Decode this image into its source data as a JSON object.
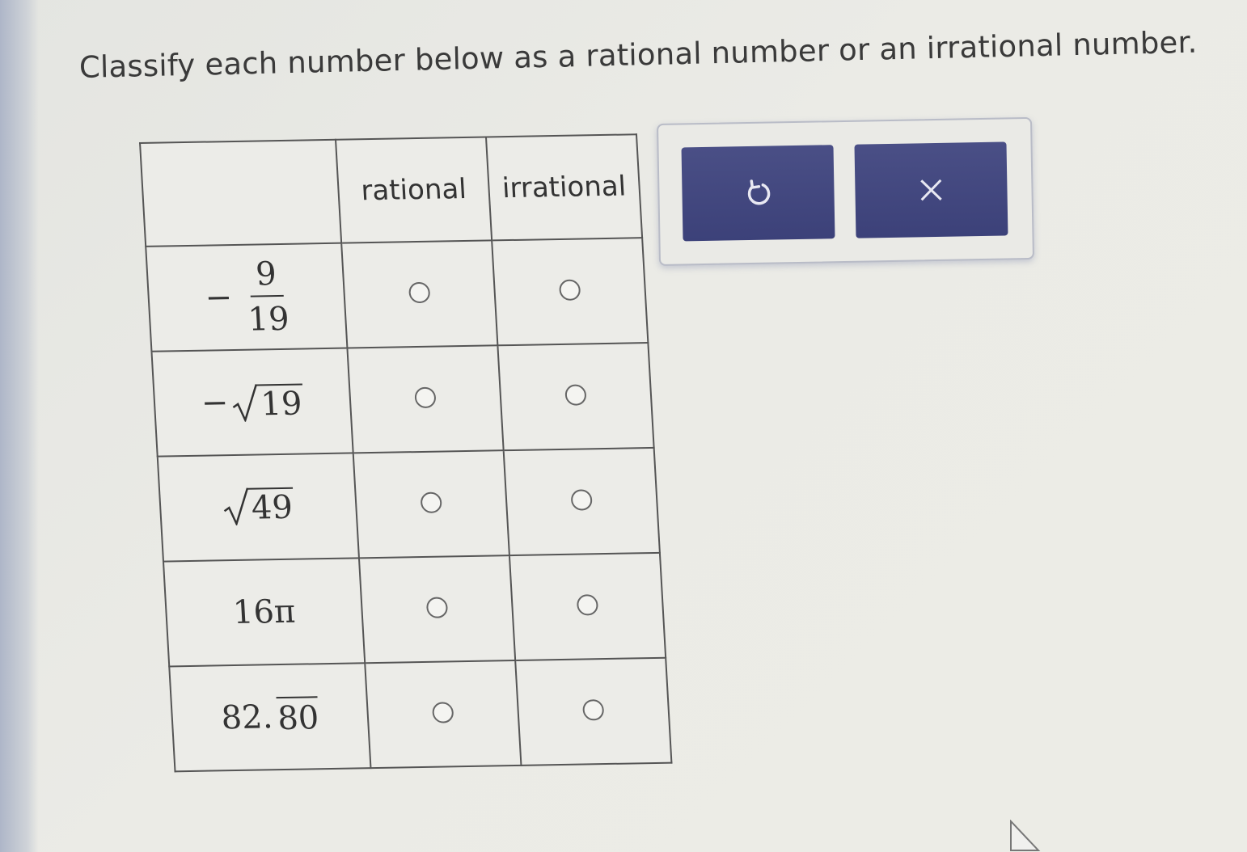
{
  "prompt": "Classify each number below as a rational number or an irrational number.",
  "table": {
    "columns": [
      "rational",
      "irrational"
    ],
    "rows": [
      {
        "sign": "−",
        "numerator": "9",
        "denominator": "19"
      },
      {
        "sign": "−",
        "radicand": "19"
      },
      {
        "radicand": "49"
      },
      {
        "text": "16π"
      },
      {
        "integer_part": "82.",
        "repeating": "80"
      }
    ]
  },
  "icons": {
    "undo": "undo-icon",
    "clear": "close-icon",
    "radio": "radio-button",
    "pointer": "mouse-pointer-icon"
  },
  "colors": {
    "button": "#434880",
    "table_border": "#555555",
    "background": "#ebebe6"
  }
}
